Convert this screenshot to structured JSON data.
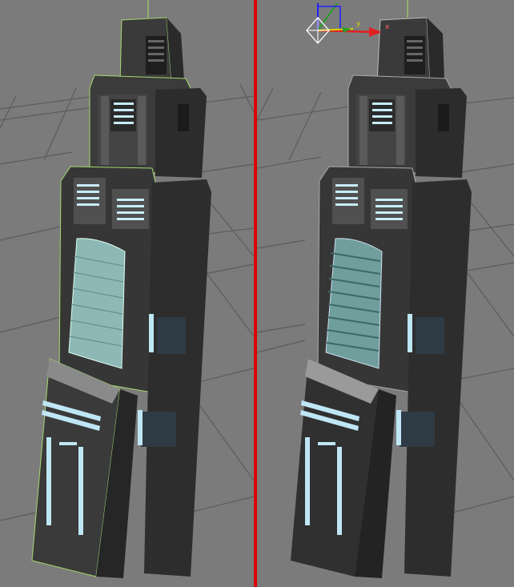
{
  "viewports": [
    {
      "name": "left",
      "active": false,
      "model": "skyscraper",
      "wireframe_overlay": true
    },
    {
      "name": "right",
      "active": true,
      "model": "skyscraper",
      "selection_gizmo": true
    }
  ],
  "gizmo": {
    "axis_x": "x",
    "axis_y": "y",
    "colors": {
      "x": "#e02020",
      "y": "#d8d800",
      "z": "#2020ff",
      "plane": "#ffd400"
    }
  },
  "colors": {
    "viewport_bg": "#7b7b7b",
    "grid": "#5e5e5e",
    "active_border": "#e00000",
    "building_dark": "#2b2b2b",
    "building_mid": "#4a4a4a",
    "glass": "#8fb9b8",
    "light_strip": "#bfe6f5",
    "wire_highlight": "#a4d870"
  }
}
